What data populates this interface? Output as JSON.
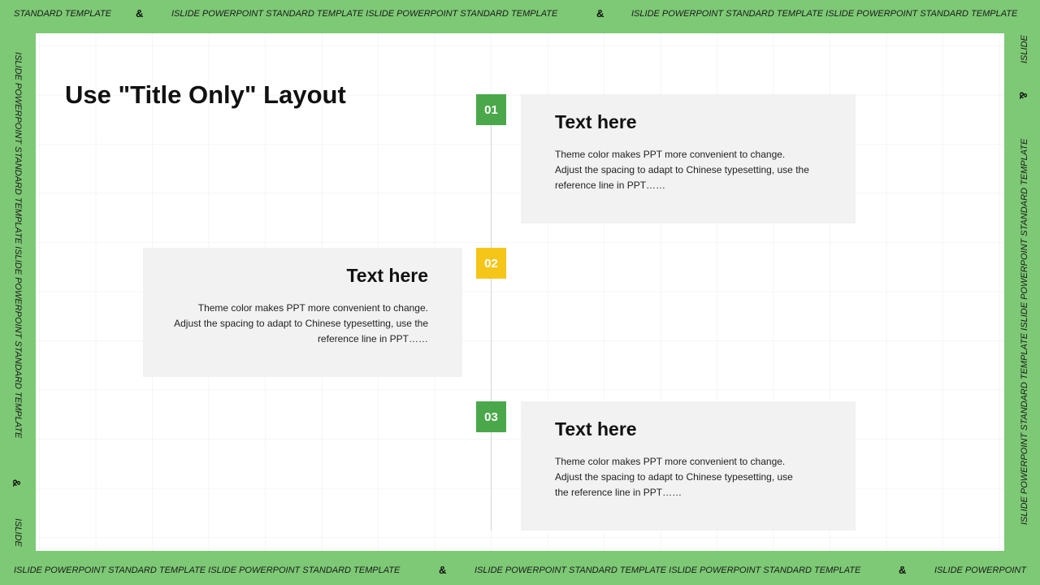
{
  "frame": {
    "top_segments": [
      "STANDARD TEMPLATE",
      "ISLIDE POWERPOINT STANDARD TEMPLATE ISLIDE POWERPOINT STANDARD TEMPLATE",
      "ISLIDE POWERPOINT STANDARD TEMPLATE ISLIDE POWERPOINT STANDARD TEMPLATE"
    ],
    "bottom_segments": [
      "ISLIDE POWERPOINT STANDARD TEMPLATE ISLIDE POWERPOINT STANDARD TEMPLATE",
      "ISLIDE POWERPOINT STANDARD TEMPLATE ISLIDE POWERPOINT STANDARD TEMPLATE",
      "ISLIDE POWERPOINT"
    ],
    "left_segments": [
      "ISLIDE POWERPOINT STANDARD TEMPLATE ISLIDE POWERPOINT STANDARD TEMPLATE",
      "ISLIDE"
    ],
    "right_segments": [
      "ISLIDE",
      "ISLIDE POWERPOINT STANDARD TEMPLATE ISLIDE POWERPOINT STANDARD TEMPLATE"
    ],
    "ampersand": "&",
    "background_color": "#7dc975"
  },
  "slide": {
    "title": "Use \"Title Only\" Layout",
    "items": [
      {
        "number": "01",
        "badge_color": "#4aa84a",
        "heading": "Text here",
        "body_lines": [
          "Theme color makes PPT more convenient to change.",
          "Adjust the spacing to adapt to Chinese typesetting, use the",
          "reference line in PPT……"
        ]
      },
      {
        "number": "02",
        "badge_color": "#f5c518",
        "heading": "Text here",
        "body_lines": [
          "Theme color makes PPT more convenient to change.",
          "Adjust the spacing to adapt to Chinese typesetting, use the",
          "reference line in PPT……"
        ]
      },
      {
        "number": "03",
        "badge_color": "#4aa84a",
        "heading": "Text here",
        "body_lines": [
          "Theme color makes PPT more convenient to change.",
          "Adjust the spacing to adapt to Chinese typesetting, use",
          "the reference line in PPT……"
        ]
      }
    ]
  }
}
